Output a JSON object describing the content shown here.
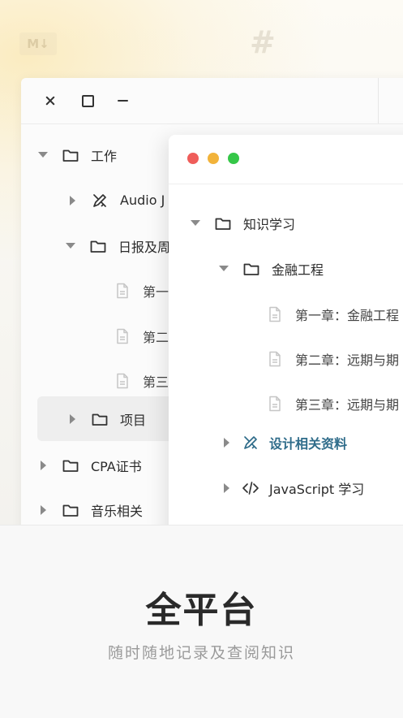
{
  "colors": {
    "accent": "#2f6c8a",
    "traffic_red": "#ef5d5a",
    "traffic_yellow": "#f2b33a",
    "traffic_green": "#35c748"
  },
  "decor": {
    "md_badge": "M↓",
    "hash": "#"
  },
  "back_window": {
    "toolbar": [
      "close-icon",
      "maximize-icon",
      "minimize-icon"
    ],
    "tree": [
      {
        "label": "工作",
        "expanded": true,
        "icon": "folder-icon"
      },
      {
        "label": "Audio J",
        "expanded": false,
        "icon": "design-icon"
      },
      {
        "label": "日报及周",
        "expanded": true,
        "icon": "folder-icon"
      },
      {
        "label": "第一",
        "icon": "file-icon"
      },
      {
        "label": "第二",
        "icon": "file-icon"
      },
      {
        "label": "第三",
        "icon": "file-icon"
      },
      {
        "label": "项目",
        "expanded": false,
        "icon": "folder-icon",
        "selected": true
      },
      {
        "label": "CPA证书",
        "expanded": false,
        "icon": "folder-icon"
      },
      {
        "label": "音乐相关",
        "expanded": false,
        "icon": "folder-icon"
      }
    ]
  },
  "front_window": {
    "tree": [
      {
        "label": "知识学习",
        "expanded": true,
        "icon": "folder-icon"
      },
      {
        "label": "金融工程",
        "expanded": true,
        "icon": "folder-icon"
      },
      {
        "label": "第一章：金融工程",
        "icon": "file-icon"
      },
      {
        "label": "第二章：远期与期",
        "icon": "file-icon"
      },
      {
        "label": "第三章：远期与期",
        "icon": "file-icon"
      },
      {
        "label": "设计相关资料",
        "expanded": false,
        "icon": "design-icon",
        "highlighted": true
      },
      {
        "label": "JavaScript 学习",
        "expanded": false,
        "icon": "code-icon"
      }
    ]
  },
  "footer": {
    "headline": "全平台",
    "subline": "随时随地记录及查阅知识"
  }
}
